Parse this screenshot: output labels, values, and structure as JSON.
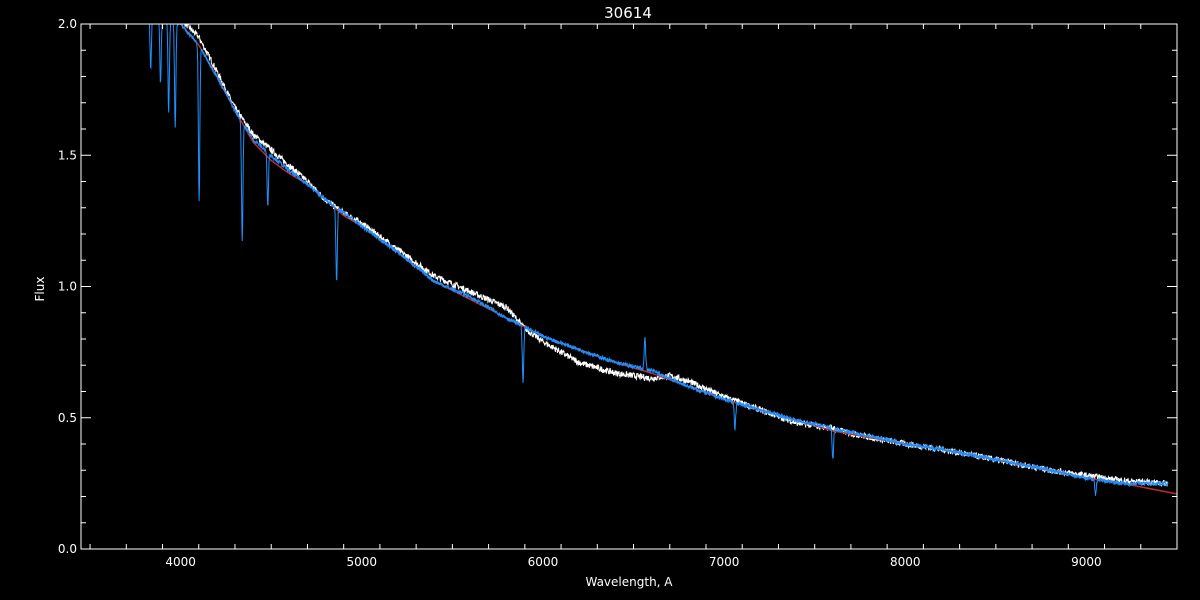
{
  "chart_data": {
    "type": "line",
    "title": "30614",
    "xlabel": "Wavelength, A",
    "ylabel": "Flux",
    "xlim": [
      3450,
      9500
    ],
    "ylim": [
      0.0,
      2.0
    ],
    "x_ticks": [
      4000,
      5000,
      6000,
      7000,
      8000,
      9000
    ],
    "x_tick_labels": [
      "4000",
      "5000",
      "6000",
      "7000",
      "8000",
      "9000"
    ],
    "y_ticks": [
      0.0,
      0.5,
      1.0,
      1.5,
      2.0
    ],
    "y_tick_labels": [
      "0.0",
      "0.5",
      "1.0",
      "1.5",
      "2.0"
    ],
    "grid": false,
    "background_color": "#000000",
    "axis_color": "#ffffff",
    "series": [
      {
        "color": "#ffffff",
        "style": "noisy-spectrum",
        "x": [
          3750,
          4000,
          4100,
          4200,
          4300,
          4400,
          4500,
          4600,
          4700,
          4800,
          4900,
          5000,
          5200,
          5400,
          5600,
          5800,
          5900,
          6000,
          6200,
          6400,
          6600,
          6700,
          6800,
          7000,
          7200,
          7400,
          7600,
          7700,
          8000,
          8200,
          8500,
          8800,
          9000,
          9200,
          9450
        ],
        "y": [
          2.05,
          2.02,
          1.95,
          1.82,
          1.68,
          1.58,
          1.52,
          1.46,
          1.4,
          1.33,
          1.28,
          1.24,
          1.14,
          1.04,
          0.98,
          0.92,
          0.84,
          0.79,
          0.71,
          0.67,
          0.65,
          0.66,
          0.64,
          0.58,
          0.53,
          0.48,
          0.46,
          0.44,
          0.4,
          0.38,
          0.34,
          0.3,
          0.28,
          0.26,
          0.25
        ]
      },
      {
        "color": "#c0282d",
        "style": "smooth",
        "x": [
          3450,
          4000,
          4100,
          4200,
          4300,
          4400,
          4500,
          4600,
          4700,
          4800,
          4900,
          5000,
          5200,
          5400,
          5600,
          5800,
          6000,
          6200,
          6400,
          6600,
          6800,
          7000,
          7200,
          7400,
          7600,
          8000,
          8200,
          8500,
          8800,
          9000,
          9200,
          9500
        ],
        "y": [
          2.3,
          2.0,
          1.92,
          1.8,
          1.67,
          1.55,
          1.48,
          1.43,
          1.39,
          1.33,
          1.27,
          1.23,
          1.13,
          1.02,
          0.95,
          0.88,
          0.81,
          0.76,
          0.71,
          0.67,
          0.62,
          0.57,
          0.53,
          0.49,
          0.45,
          0.4,
          0.38,
          0.34,
          0.3,
          0.27,
          0.25,
          0.21
        ]
      },
      {
        "color": "#1e90ff",
        "style": "absorption-spectrum",
        "x": [
          3750,
          4000,
          4100,
          4200,
          4300,
          4400,
          4500,
          4600,
          4700,
          4800,
          4900,
          5000,
          5200,
          5400,
          5600,
          5800,
          6000,
          6200,
          6400,
          6600,
          6800,
          7000,
          7200,
          7400,
          7600,
          8000,
          8200,
          8500,
          8800,
          9000,
          9200,
          9450
        ],
        "y": [
          2.05,
          2.0,
          1.92,
          1.8,
          1.67,
          1.56,
          1.5,
          1.44,
          1.39,
          1.33,
          1.28,
          1.23,
          1.13,
          1.02,
          0.96,
          0.88,
          0.81,
          0.76,
          0.71,
          0.68,
          0.62,
          0.57,
          0.53,
          0.49,
          0.46,
          0.4,
          0.38,
          0.34,
          0.3,
          0.27,
          0.25,
          0.25
        ],
        "absorption_lines": [
          {
            "x": 3835,
            "depth": 0.2
          },
          {
            "x": 3889,
            "depth": 0.25
          },
          {
            "x": 3934,
            "depth": 0.35
          },
          {
            "x": 3970,
            "depth": 0.4
          },
          {
            "x": 4102,
            "depth": 0.6
          },
          {
            "x": 4340,
            "depth": 0.45
          },
          {
            "x": 4481,
            "depth": 0.2
          },
          {
            "x": 4861,
            "depth": 0.28
          },
          {
            "x": 5890,
            "depth": 0.22
          },
          {
            "x": 6563,
            "depth": -0.12
          },
          {
            "x": 7060,
            "depth": 0.1
          },
          {
            "x": 7600,
            "depth": 0.12
          },
          {
            "x": 9050,
            "depth": 0.06
          }
        ]
      },
      {
        "color": "#1e90ff",
        "style": "baseline",
        "x": [
          3450,
          9500
        ],
        "y": [
          0.0,
          0.0
        ]
      }
    ]
  }
}
